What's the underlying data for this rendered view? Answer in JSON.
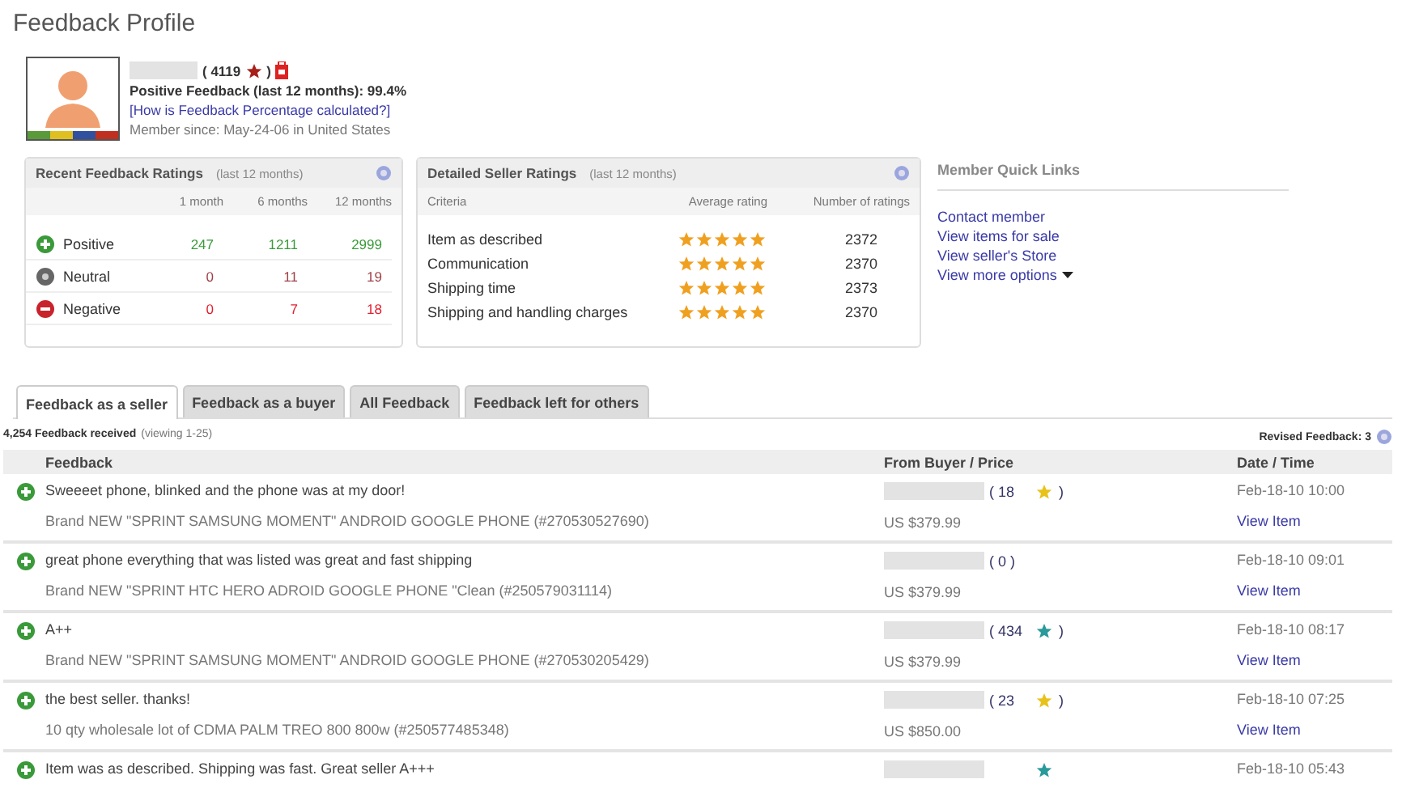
{
  "page_title": "Feedback Profile",
  "profile": {
    "score": "( 4119",
    "score_close": ")",
    "positive_line": "Positive Feedback (last 12 months): 99.4%",
    "help_link": "[How is Feedback Percentage calculated?]",
    "member_since": "Member since: May-24-06 in United States"
  },
  "recent_ratings": {
    "title": "Recent Feedback Ratings",
    "subtitle": "(last 12 months)",
    "columns": [
      "1 month",
      "6 months",
      "12 months"
    ],
    "rows": [
      {
        "kind": "positive",
        "label": "Positive",
        "values": [
          "247",
          "1211",
          "2999"
        ]
      },
      {
        "kind": "neutral",
        "label": "Neutral",
        "values": [
          "0",
          "11",
          "19"
        ]
      },
      {
        "kind": "negative",
        "label": "Negative",
        "values": [
          "0",
          "7",
          "18"
        ]
      }
    ]
  },
  "seller_ratings": {
    "title": "Detailed Seller Ratings",
    "subtitle": "(last 12 months)",
    "columns": [
      "Criteria",
      "Average rating",
      "Number of ratings"
    ],
    "rows": [
      {
        "criteria": "Item as described",
        "stars": 5,
        "count": "2372"
      },
      {
        "criteria": "Communication",
        "stars": 5,
        "count": "2370"
      },
      {
        "criteria": "Shipping time",
        "stars": 5,
        "count": "2373"
      },
      {
        "criteria": "Shipping and handling charges",
        "stars": 5,
        "count": "2370"
      }
    ]
  },
  "quick_links": {
    "title": "Member Quick Links",
    "links": [
      "Contact member",
      "View items for sale",
      "View seller's Store",
      "View more options"
    ]
  },
  "tabs": [
    {
      "label": "Feedback as a seller",
      "selected": true
    },
    {
      "label": "Feedback as a buyer",
      "selected": false
    },
    {
      "label": "All Feedback",
      "selected": false
    },
    {
      "label": "Feedback left for others",
      "selected": false
    }
  ],
  "summary": {
    "count": "4,254 Feedback received",
    "viewing": "(viewing 1-25)",
    "revised": "Revised Feedback: 3"
  },
  "table": {
    "columns": [
      "Feedback",
      "From Buyer / Price",
      "Date / Time"
    ],
    "rows": [
      {
        "kind": "positive",
        "comment": "Sweeeet phone, blinked and the phone was at my door!",
        "item": "Brand NEW \"SPRINT SAMSUNG MOMENT\" ANDROID GOOGLE PHONE (#270530527690)",
        "buyer_score": "( 18",
        "buyer_score_close": ")",
        "color": "#e8c21a",
        "price": "US $379.99",
        "date": "Feb-18-10 10:00",
        "link": "View Item"
      },
      {
        "kind": "positive",
        "comment": "great phone everything that was listed was great and fast shipping",
        "item": "Brand NEW \"SPRINT HTC HERO ADROID GOOGLE PHONE \"Clean (#250579031114)",
        "buyer_score": "( 0 )",
        "price": "US $379.99",
        "date": "Feb-18-10 09:01",
        "link": "View Item"
      },
      {
        "kind": "positive",
        "comment": "A++",
        "item": "Brand NEW \"SPRINT SAMSUNG MOMENT\" ANDROID GOOGLE PHONE (#270530205429)",
        "buyer_score": "( 434",
        "buyer_score_close": ")",
        "color": "#2a9a9a",
        "price": "US $379.99",
        "date": "Feb-18-10 08:17",
        "link": "View Item"
      },
      {
        "kind": "positive",
        "comment": "the best seller. thanks!",
        "item": "10 qty wholesale lot of CDMA PALM TREO 800 800w (#250577485348)",
        "buyer_score": "( 23",
        "buyer_score_close": ")",
        "color": "#e8c21a",
        "price": "US $850.00",
        "date": "Feb-18-10 07:25",
        "link": "View Item"
      },
      {
        "kind": "positive",
        "comment": "Item was as described. Shipping was fast. Great seller A+++",
        "color": "#2a9a9a",
        "date": "Feb-18-10 05:43"
      }
    ]
  }
}
